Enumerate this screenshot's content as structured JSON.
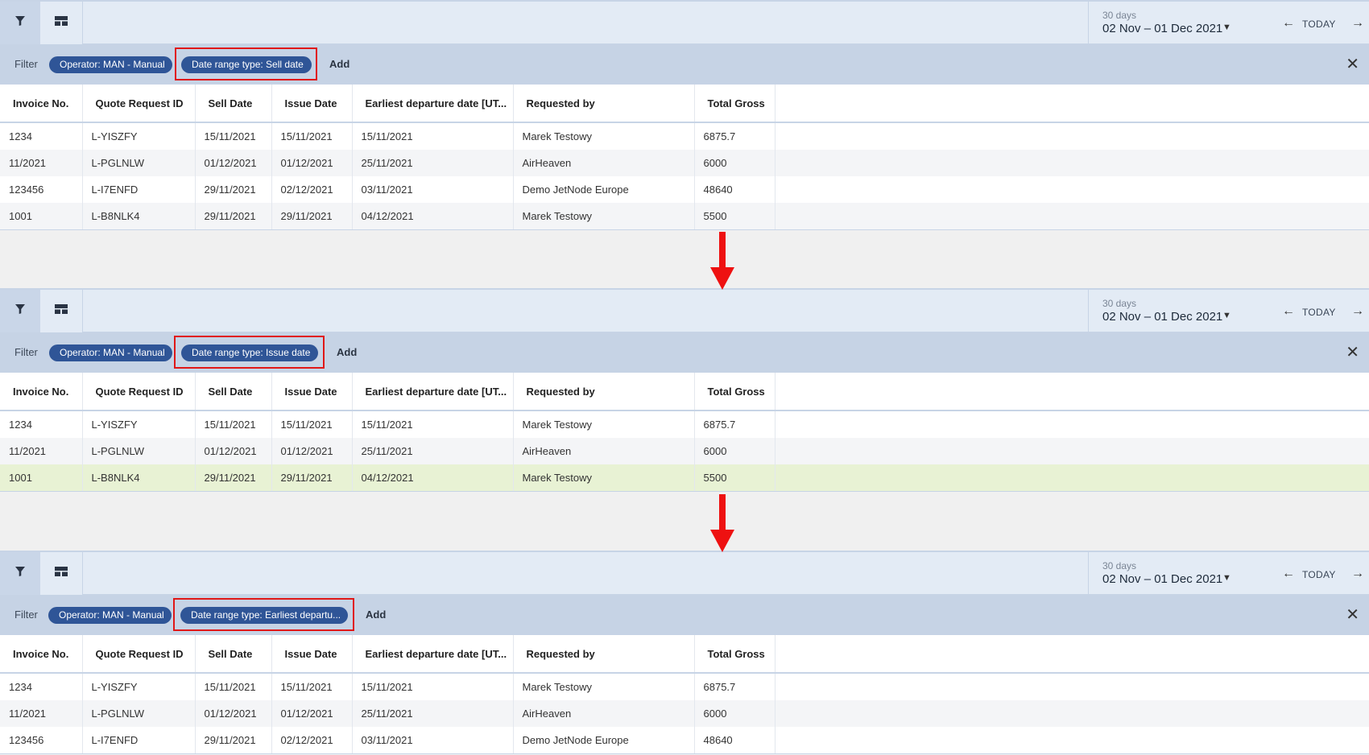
{
  "common": {
    "range_sub": "30 days",
    "range_main": "02 Nov – 01 Dec 2021",
    "today": "TODAY",
    "filter_label": "Filter",
    "add_label": "Add",
    "operator_chip": "Operator: MAN - Manual",
    "columns": [
      "Invoice No.",
      "Quote Request ID",
      "Sell Date",
      "Issue Date",
      "Earliest departure date [UT...",
      "Requested by",
      "Total Gross"
    ]
  },
  "panels": [
    {
      "date_chip": "Date range type: Sell date",
      "rows": [
        [
          "1234",
          "L-YISZFY",
          "15/11/2021",
          "15/11/2021",
          "15/11/2021",
          "Marek Testowy",
          "6875.7"
        ],
        [
          "11/2021",
          "L-PGLNLW",
          "01/12/2021",
          "01/12/2021",
          "25/11/2021",
          "AirHeaven",
          "6000"
        ],
        [
          "123456",
          "L-I7ENFD",
          "29/11/2021",
          "02/12/2021",
          "03/11/2021",
          "Demo JetNode Europe",
          "48640"
        ],
        [
          "1001",
          "L-B8NLK4",
          "29/11/2021",
          "29/11/2021",
          "04/12/2021",
          "Marek Testowy",
          "5500"
        ]
      ]
    },
    {
      "date_chip": "Date range type: Issue date",
      "rows": [
        [
          "1234",
          "L-YISZFY",
          "15/11/2021",
          "15/11/2021",
          "15/11/2021",
          "Marek Testowy",
          "6875.7"
        ],
        [
          "11/2021",
          "L-PGLNLW",
          "01/12/2021",
          "01/12/2021",
          "25/11/2021",
          "AirHeaven",
          "6000"
        ],
        [
          "1001",
          "L-B8NLK4",
          "29/11/2021",
          "29/11/2021",
          "04/12/2021",
          "Marek Testowy",
          "5500"
        ]
      ],
      "selected_row": 2
    },
    {
      "date_chip": "Date range type: Earliest departu...",
      "rows": [
        [
          "1234",
          "L-YISZFY",
          "15/11/2021",
          "15/11/2021",
          "15/11/2021",
          "Marek Testowy",
          "6875.7"
        ],
        [
          "11/2021",
          "L-PGLNLW",
          "01/12/2021",
          "01/12/2021",
          "25/11/2021",
          "AirHeaven",
          "6000"
        ],
        [
          "123456",
          "L-I7ENFD",
          "29/11/2021",
          "02/12/2021",
          "03/11/2021",
          "Demo JetNode Europe",
          "48640"
        ]
      ]
    }
  ],
  "colors": {
    "chip": "#2f5597",
    "highlight": "#e01717",
    "arrow": "#ee1111",
    "selected_row": "#e8f2d4"
  }
}
